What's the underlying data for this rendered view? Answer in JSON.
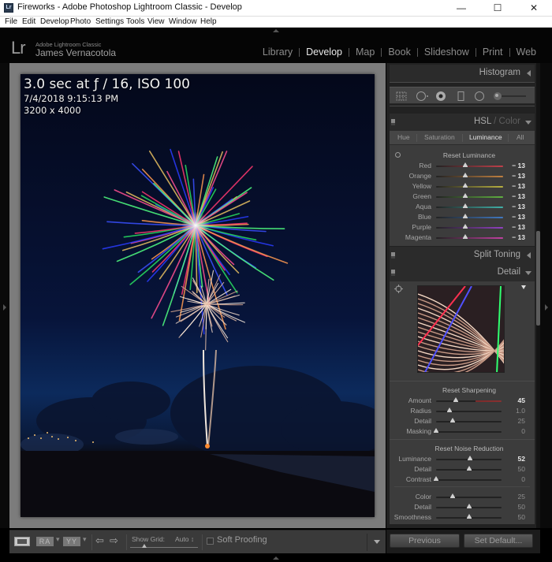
{
  "window": {
    "title": "Fireworks - Adobe Photoshop Lightroom Classic - Develop",
    "app_icon": "Lr",
    "minimize": "—",
    "maximize": "☐",
    "close": "✕"
  },
  "menubar": {
    "items": [
      "File",
      "Edit",
      "Develop",
      "Photo",
      "Settings",
      "Tools",
      "View",
      "Window",
      "Help"
    ]
  },
  "identity": {
    "logo": "Lr",
    "product": "Adobe Lightroom Classic",
    "user": "James Vernacotola"
  },
  "modules": {
    "items": [
      "Library",
      "Develop",
      "Map",
      "Book",
      "Slideshow",
      "Print",
      "Web"
    ],
    "active": "Develop"
  },
  "photo_info": {
    "exposure": "3.0 sec at ƒ / 16, ISO 100",
    "datetime": "7/4/2018 9:15:13 PM",
    "dimensions": "3200 x 4000"
  },
  "toolbar": {
    "ra_label": "RA",
    "yy_label": "YY",
    "dash": "▾",
    "prev_arrow": "⇦",
    "next_arrow": "⇨",
    "show_grid_label": "Show Grid:",
    "show_grid_value": "Auto ↕",
    "soft_proofing_label": "Soft Proofing",
    "soft_proofing_checked": false
  },
  "panels": {
    "histogram": {
      "title": "Histogram"
    },
    "tools": [
      "crop-overlay",
      "spot-removal",
      "red-eye",
      "graduated-filter",
      "radial-filter",
      "adjustment-brush"
    ],
    "hsl": {
      "title_main": "HSL",
      "title_sep": " / ",
      "title_alt": "Color",
      "tabs": [
        "Hue",
        "Saturation",
        "Luminance",
        "All"
      ],
      "active_tab": "Luminance",
      "reset_label": "Reset Luminance",
      "sliders": [
        {
          "label": "Red",
          "value": "− 13",
          "level": -13,
          "color": "#c0404a"
        },
        {
          "label": "Orange",
          "value": "− 13",
          "level": -13,
          "color": "#c08040"
        },
        {
          "label": "Yellow",
          "value": "− 13",
          "level": -13,
          "color": "#b8b040"
        },
        {
          "label": "Green",
          "value": "− 13",
          "level": -13,
          "color": "#60b040"
        },
        {
          "label": "Aqua",
          "value": "− 13",
          "level": -13,
          "color": "#40b0a8"
        },
        {
          "label": "Blue",
          "value": "− 13",
          "level": -13,
          "color": "#4078c0"
        },
        {
          "label": "Purple",
          "value": "− 13",
          "level": -13,
          "color": "#9040c0"
        },
        {
          "label": "Magenta",
          "value": "− 13",
          "level": -13,
          "color": "#c040a0"
        }
      ]
    },
    "split_toning": {
      "title": "Split Toning"
    },
    "detail": {
      "title": "Detail",
      "sharpening": {
        "reset_label": "Reset Sharpening",
        "sliders": [
          {
            "label": "Amount",
            "value": "45",
            "fraction": 0.3,
            "highlight": true
          },
          {
            "label": "Radius",
            "value": "1.0",
            "fraction": 0.2,
            "highlight": false
          },
          {
            "label": "Detail",
            "value": "25",
            "fraction": 0.25,
            "highlight": false
          },
          {
            "label": "Masking",
            "value": "0",
            "fraction": 0.0,
            "highlight": false
          }
        ]
      },
      "noise_reduction": {
        "reset_label": "Reset Noise Reduction",
        "sliders": [
          {
            "label": "Luminance",
            "value": "52",
            "fraction": 0.52,
            "highlight": true
          },
          {
            "label": "Detail",
            "value": "50",
            "fraction": 0.5,
            "highlight": false
          },
          {
            "label": "Contrast",
            "value": "0",
            "fraction": 0.0,
            "highlight": false
          }
        ],
        "color_sliders": [
          {
            "label": "Color",
            "value": "25",
            "fraction": 0.25,
            "highlight": false
          },
          {
            "label": "Detail",
            "value": "50",
            "fraction": 0.5,
            "highlight": false
          },
          {
            "label": "Smoothness",
            "value": "50",
            "fraction": 0.5,
            "highlight": false
          }
        ]
      }
    }
  },
  "buttons": {
    "previous": "Previous",
    "set_default": "Set Default..."
  }
}
